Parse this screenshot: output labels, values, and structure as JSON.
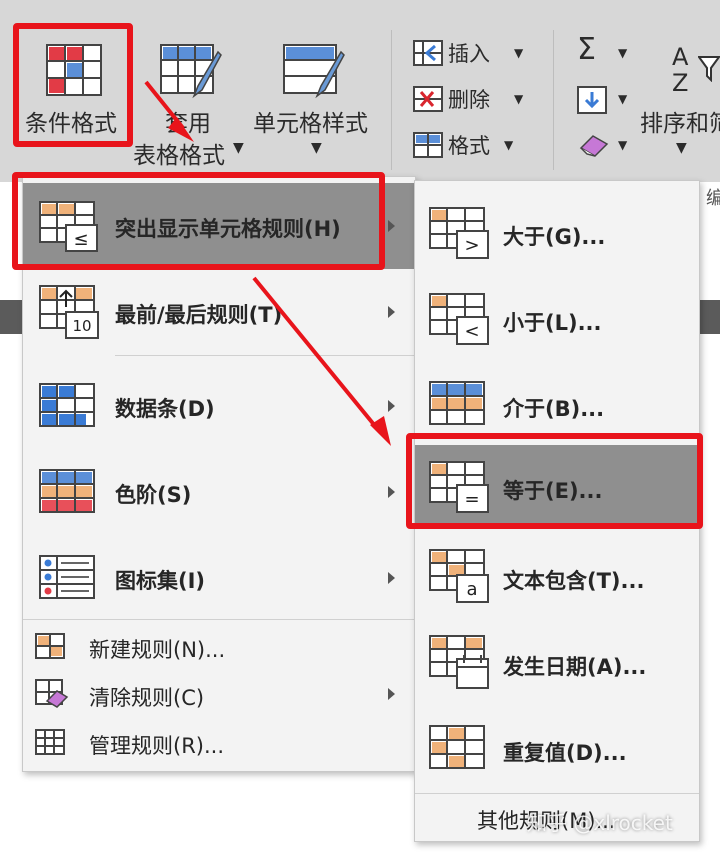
{
  "ribbon": {
    "conditional_format": "条件格式",
    "table_format_line1": "套用",
    "table_format_line2": "表格格式",
    "cell_style": "单元格样式",
    "insert": "插入",
    "delete": "删除",
    "format": "格式",
    "sort_filter": "排序和筛",
    "sum_symbol": "Σ",
    "sort_glyph": "A Z",
    "group_fragment": "编"
  },
  "main_menu": {
    "items": [
      {
        "label": "突出显示单元格规则(H)",
        "icon": "highlight-rules-icon",
        "submenu": true
      },
      {
        "label": "最前/最后规则(T)",
        "icon": "top-bottom-icon",
        "submenu": true,
        "badge": "10"
      },
      {
        "label": "数据条(D)",
        "icon": "data-bars-icon",
        "submenu": true
      },
      {
        "label": "色阶(S)",
        "icon": "color-scales-icon",
        "submenu": true
      },
      {
        "label": "图标集(I)",
        "icon": "icon-sets-icon",
        "submenu": true
      },
      {
        "label": "新建规则(N)...",
        "icon": "new-rule-icon",
        "submenu": false
      },
      {
        "label": "清除规则(C)",
        "icon": "clear-rules-icon",
        "submenu": true
      },
      {
        "label": "管理规则(R)...",
        "icon": "manage-rules-icon",
        "submenu": false
      }
    ]
  },
  "sub_menu": {
    "items": [
      {
        "label": "大于(G)...",
        "symbol": ">"
      },
      {
        "label": "小于(L)...",
        "symbol": "<"
      },
      {
        "label": "介于(B)...",
        "symbol": ""
      },
      {
        "label": "等于(E)...",
        "symbol": "="
      },
      {
        "label": "文本包含(T)...",
        "symbol": "a"
      },
      {
        "label": "发生日期(A)...",
        "symbol": ""
      },
      {
        "label": "重复值(D)...",
        "symbol": ""
      }
    ],
    "more": "其他规则(M)...",
    "watermark": "知乎 @xlrocket"
  },
  "symbols": {
    "le": "≤"
  },
  "colors": {
    "highlight": "#e8141b",
    "selected": "#8f8f8f",
    "arrow": "#e8141b"
  }
}
